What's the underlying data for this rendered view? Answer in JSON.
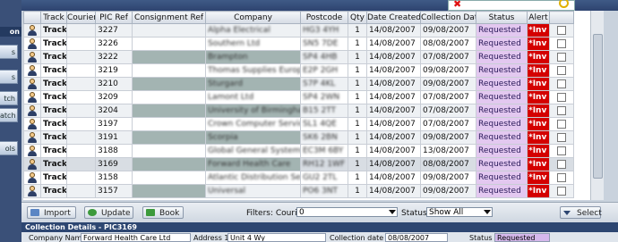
{
  "sidebar": {
    "header": "on",
    "buttons": [
      "s",
      "s",
      "tch",
      "atch",
      "ols"
    ]
  },
  "grid": {
    "columns": [
      "",
      "Track",
      "Courier",
      "PIC Ref",
      "Consignment Ref",
      "Company",
      "Postcode",
      "Qty",
      "Date Created",
      "Collection Date",
      "Status",
      "Alert",
      ""
    ],
    "rows": [
      {
        "track": "Track",
        "courier": "",
        "pic": "3227",
        "consignment": "",
        "company": "Alpha Electrical",
        "postcode": "HG3 4YH",
        "qty": "1",
        "created": "14/08/2007",
        "collection": "09/08/2007",
        "status": "Requested",
        "alert": "*Inv",
        "bc": false,
        "bk": false,
        "sel": false
      },
      {
        "track": "Track",
        "courier": "",
        "pic": "3226",
        "consignment": "",
        "company": "Southern Ltd",
        "postcode": "SN5 7DE",
        "qty": "1",
        "created": "14/08/2007",
        "collection": "08/08/2007",
        "status": "Requested",
        "alert": "*Inv",
        "bc": false,
        "bk": false,
        "sel": false
      },
      {
        "track": "Track",
        "courier": "",
        "pic": "3222",
        "consignment": "",
        "company": "Brampton",
        "postcode": "SP4 4HB",
        "qty": "1",
        "created": "14/08/2007",
        "collection": "07/08/2007",
        "status": "Requested",
        "alert": "*Inv",
        "bc": true,
        "bk": true,
        "sel": false
      },
      {
        "track": "Track",
        "courier": "",
        "pic": "3219",
        "consignment": "",
        "company": "Thomas Supplies Europe",
        "postcode": "E2P 2GH",
        "qty": "1",
        "created": "14/08/2007",
        "collection": "09/08/2007",
        "status": "Requested",
        "alert": "*Inv",
        "bc": false,
        "bk": false,
        "sel": false
      },
      {
        "track": "Track",
        "courier": "",
        "pic": "3210",
        "consignment": "",
        "company": "Sturgard",
        "postcode": "S7P 4KL",
        "qty": "1",
        "created": "14/08/2007",
        "collection": "09/08/2007",
        "status": "Requested",
        "alert": "*Inv",
        "bc": true,
        "bk": true,
        "sel": false
      },
      {
        "track": "Track",
        "courier": "",
        "pic": "3209",
        "consignment": "",
        "company": "Lamont Ltd",
        "postcode": "SP4 2WN",
        "qty": "1",
        "created": "14/08/2007",
        "collection": "07/08/2007",
        "status": "Requested",
        "alert": "*Inv",
        "bc": false,
        "bk": false,
        "sel": false
      },
      {
        "track": "Track",
        "courier": "",
        "pic": "3204",
        "consignment": "",
        "company": "University of Birmingham",
        "postcode": "B15 2TT",
        "qty": "1",
        "created": "14/08/2007",
        "collection": "07/08/2007",
        "status": "Requested",
        "alert": "*Inv",
        "bc": true,
        "bk": true,
        "sel": false
      },
      {
        "track": "Track",
        "courier": "",
        "pic": "3197",
        "consignment": "",
        "company": "Crown Computer Services",
        "postcode": "SL1 4QE",
        "qty": "1",
        "created": "14/08/2007",
        "collection": "07/08/2007",
        "status": "Requested",
        "alert": "*Inv",
        "bc": false,
        "bk": false,
        "sel": false
      },
      {
        "track": "Track",
        "courier": "",
        "pic": "3191",
        "consignment": "",
        "company": "Scorpia",
        "postcode": "SK6 2BN",
        "qty": "1",
        "created": "14/08/2007",
        "collection": "09/08/2007",
        "status": "Requested",
        "alert": "*Inv",
        "bc": true,
        "bk": true,
        "sel": false
      },
      {
        "track": "Track",
        "courier": "",
        "pic": "3188",
        "consignment": "",
        "company": "Global General Systems",
        "postcode": "EC3M 6BY",
        "qty": "1",
        "created": "14/08/2007",
        "collection": "13/08/2007",
        "status": "Requested",
        "alert": "*Inv",
        "bc": false,
        "bk": false,
        "sel": false
      },
      {
        "track": "Track",
        "courier": "",
        "pic": "3169",
        "consignment": "",
        "company": "Forward Health Care",
        "postcode": "RH12 1WF",
        "qty": "1",
        "created": "14/08/2007",
        "collection": "08/08/2007",
        "status": "Requested",
        "alert": "*Inv",
        "bc": true,
        "bk": true,
        "sel": true
      },
      {
        "track": "Track",
        "courier": "",
        "pic": "3158",
        "consignment": "",
        "company": "Atlantic Distribution Services",
        "postcode": "GU2 2TL",
        "qty": "1",
        "created": "14/08/2007",
        "collection": "09/08/2007",
        "status": "Requested",
        "alert": "*Inv",
        "bc": false,
        "bk": false,
        "sel": false
      },
      {
        "track": "Track",
        "courier": "",
        "pic": "3157",
        "consignment": "",
        "company": "Universal",
        "postcode": "PO6 3NT",
        "qty": "1",
        "created": "14/08/2007",
        "collection": "09/08/2007",
        "status": "Requested",
        "alert": "*Inv",
        "bc": true,
        "bk": false,
        "sel": false
      }
    ]
  },
  "toolbar": {
    "import_label": "Import",
    "update_label": "Update",
    "book_label": "Book",
    "filters_label": "Filters: Courier",
    "courier_value": "0",
    "status_label": "Status",
    "status_value": "Show All",
    "select_label": "Select"
  },
  "details": {
    "header": "Collection Details - PIC3169",
    "company_label": "Company Name",
    "company_value": "Forward Health Care Ltd",
    "address_label": "Address 1",
    "address_value": "Unit 4 Wy",
    "coll_date_label": "Collection date",
    "coll_date_value": "08/08/2007",
    "status_label": "Status",
    "status_value": "Requested"
  },
  "colors": {
    "status_bg": "#e3c8f0",
    "alert_bg": "#d40000",
    "header_bar": "#2d4671"
  }
}
